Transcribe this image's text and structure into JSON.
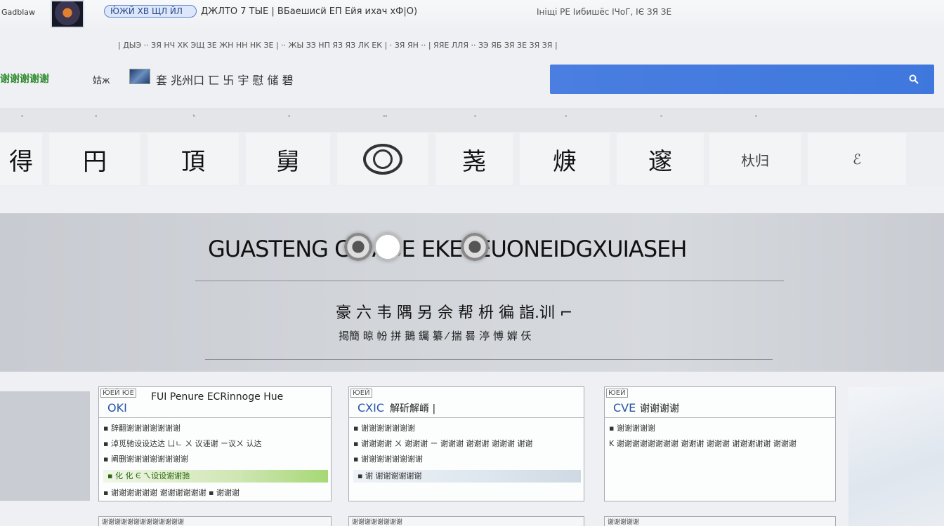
{
  "topbar": {
    "site_name": "Gadblaw",
    "nav_pill": "Ю́ЖЙ ХВ ЩЛ ЙЛ",
    "nav_text": "ДЖЛТО 7 ТЫЕ | ВБаешисй ЕП Ейя ихач хФ|О)",
    "nav_right": "Ініщі РЕ Іибишёс ІЧоГ, ІЄ ЗЯ ЗЕ"
  },
  "link_row": "| ДЫЭ ·· ЗЯ НЧ ХК ЭЩ ЗЕ ЖН НН НК ЗЕ | ·· ЖЫ ЗЗ НП ЯЗ ЯЗ ЛК ЕК | · ЗЯ ЯН ·· | ЯЯЕ ЛЛЯ ·· ЗЭ ЯБ ЗЯ ЗЕ ЗЯ ЗЯ |",
  "brand": {
    "green": "谢谢谢谢谢",
    "tag": "姑ж",
    "slogan": "套 兆州口 匸 卐 宇 慰 储 碧"
  },
  "search": {
    "placeholder": "",
    "icon": "search-icon"
  },
  "categories": [
    {
      "label": "ᵃ",
      "glyph": "得",
      "small": false
    },
    {
      "label": "ᵃ",
      "glyph": "円",
      "small": false
    },
    {
      "label": "ᵇ",
      "glyph": "頂",
      "small": false
    },
    {
      "label": "ᵃ",
      "glyph": "舅",
      "small": false
    },
    {
      "label": "ᵃᵃ",
      "glyph": "",
      "small": false,
      "ring": true
    },
    {
      "label": "ᵃ",
      "glyph": "荛",
      "small": false
    },
    {
      "label": "ᵃ",
      "glyph": "焿",
      "small": false
    },
    {
      "label": "ᵃ",
      "glyph": "邃",
      "small": false
    },
    {
      "label": "ᵃ",
      "glyph": "杕归",
      "small": true
    },
    {
      "label": "",
      "glyph": "ℰ",
      "small": true
    }
  ],
  "hero": {
    "title": "GUASTENG CH        ABE   EKEBEUONEIDGXUIASEH",
    "subtitle": "豪 六 韦 隅 另 佘 帮 枡 徧 詣.训 ⌐",
    "subtitle2": "揭簡 晾 帉 拼 鵝 钃 纂 ⁄  揣 晷 渟 愽 婩 仸"
  },
  "cards": [
    {
      "tag": "Ю́ЕЙ ЮЕ",
      "code": "OKI",
      "title": "FUI Penure ECRinnoge Hue",
      "lines": [
        {
          "text": "▪ 辞翻谢谢谢谢谢谢谢",
          "kind": "plain"
        },
        {
          "text": "▪ 淖觅驰设设达达 ㄩㄴ ㄨ 议诬谢 ㄧ议ㄨ 认达",
          "kind": "plain"
        },
        {
          "text": "▪ 阐删谢谢谢谢谢谢谢谢",
          "kind": "plain"
        },
        {
          "text": "▪ 化 化  Є ㄟ设设谢谢驰",
          "kind": "hl"
        }
      ],
      "foot": "▪ 谢谢谢谢谢谢 谢谢谢谢谢谢 ▪ 谢谢谢"
    },
    {
      "tag": "ЮЕЙ",
      "code": "CXIC",
      "title": "解斫解嵴 |",
      "lines": [
        {
          "text": "▪ 谢谢谢谢谢谢谢",
          "kind": "plain"
        },
        {
          "text": "▪ 谢谢谢谢 ㄨ 谢谢谢 ㄧ 谢谢谢 谢谢谢 谢谢谢 谢谢",
          "kind": "plain"
        },
        {
          "text": "▪ 谢谢谢谢谢谢谢谢",
          "kind": "plain"
        },
        {
          "text": "▪ 谢 谢谢谢谢谢谢",
          "kind": "hl2"
        }
      ],
      "foot": ""
    },
    {
      "tag": "ЮЕЙ",
      "code": "CVE",
      "title": "谢谢谢谢",
      "lines": [
        {
          "text": "▪ 谢谢谢谢谢",
          "kind": "plain"
        },
        {
          "text": "K 谢谢谢谢谢谢谢谢 谢谢谢 谢谢谢 谢谢谢谢谢 谢谢谢",
          "kind": "plain"
        }
      ],
      "foot": ""
    }
  ],
  "bottom_tabs": [
    "谢谢谢谢谢谢谢谢谢谢谢谢谢",
    "谢谢谢谢谢谢谢谢",
    "谢谢谢谢谢"
  ]
}
